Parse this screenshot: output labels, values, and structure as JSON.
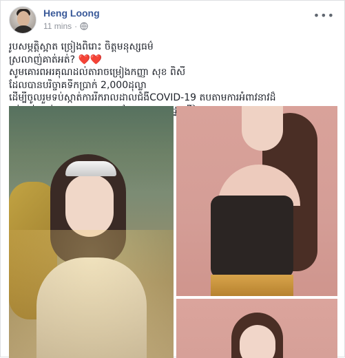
{
  "post": {
    "author": "Heng Loong",
    "timestamp": "11 mins",
    "separator": "·",
    "privacy_icon": "globe-icon",
    "menu_icon": "more-options-icon",
    "text_lines": [
      "រូបសម្ភត្តិស្អាត ច្រៀងពិរោះ ចិត្តមនុស្សធម៌",
      "ស្រលាញ់គាត់អត់?",
      "សូមគោរពអរគុណដល់តារាចម្រៀងកញ្ញា សុខ ពិសី",
      "ដែលបានបរិច្ចាគទឹកប្រាក់ 2,000ដុល្លា",
      "ដើម្បីចូលរួមទប់ស្កាត់ការរីករាលដាលជំងឺCOVID-19 តបតាមការអំពាវនាវដ៏",
      "ខ្ពង់ខ្ពស់របស់សម្ដេចតេជោ ហ៊ុន សែន នាយករដ្ឋមន្ត្រីនៃព្រះរាជាណាចក្រកម្ពុជា។"
    ],
    "hearts": "❤️❤️",
    "colors": {
      "author": "#385898",
      "meta": "#90949c",
      "text": "#1d2129"
    }
  }
}
